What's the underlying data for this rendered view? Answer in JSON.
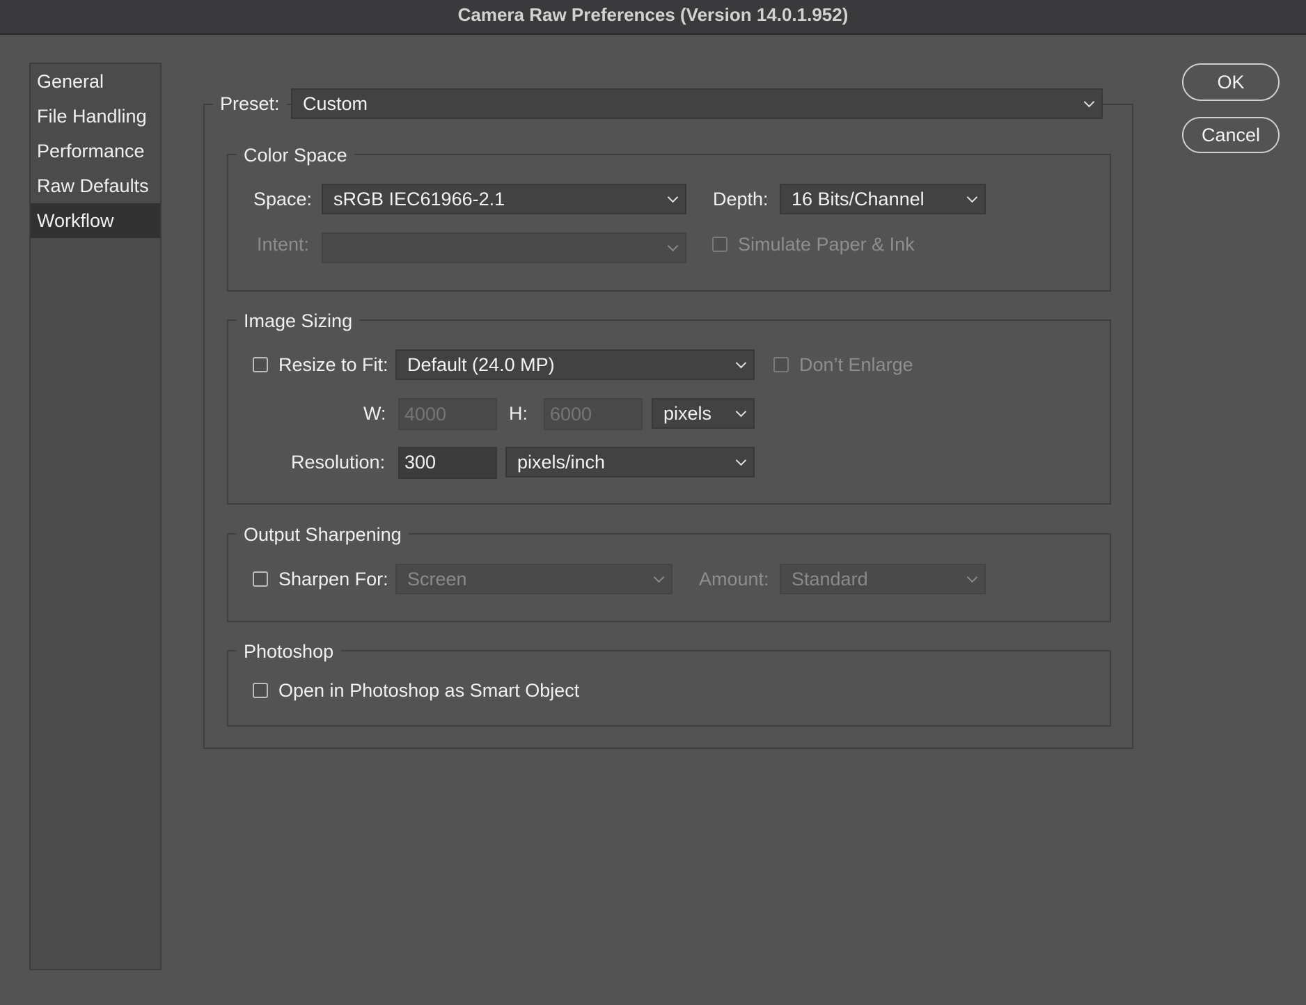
{
  "window": {
    "title": "Camera Raw Preferences  (Version 14.0.1.952)"
  },
  "sidebar": {
    "items": [
      {
        "label": "General"
      },
      {
        "label": "File Handling"
      },
      {
        "label": "Performance"
      },
      {
        "label": "Raw Defaults"
      },
      {
        "label": "Workflow",
        "selected": true
      }
    ]
  },
  "buttons": {
    "ok_label": "OK",
    "cancel_label": "Cancel"
  },
  "preset": {
    "label": "Preset:",
    "value": "Custom"
  },
  "color_space": {
    "title": "Color Space",
    "space_label": "Space:",
    "space_value": "sRGB IEC61966-2.1",
    "depth_label": "Depth:",
    "depth_value": "16 Bits/Channel",
    "intent_label": "Intent:",
    "intent_value": "",
    "simulate_label": "Simulate Paper & Ink",
    "simulate_checked": false
  },
  "image_sizing": {
    "title": "Image Sizing",
    "resize_label": "Resize to Fit:",
    "resize_checked": false,
    "resize_value": "Default  (24.0 MP)",
    "dont_enlarge_label": "Don’t Enlarge",
    "dont_enlarge_checked": false,
    "w_label": "W:",
    "w_placeholder": "4000",
    "h_label": "H:",
    "h_placeholder": "6000",
    "units_value": "pixels",
    "resolution_label": "Resolution:",
    "resolution_value": "300",
    "resolution_units": "pixels/inch"
  },
  "output_sharpening": {
    "title": "Output Sharpening",
    "sharpen_label": "Sharpen For:",
    "sharpen_checked": false,
    "sharpen_value": "Screen",
    "amount_label": "Amount:",
    "amount_value": "Standard"
  },
  "photoshop": {
    "title": "Photoshop",
    "smart_object_label": "Open in Photoshop as Smart Object",
    "smart_object_checked": false
  }
}
